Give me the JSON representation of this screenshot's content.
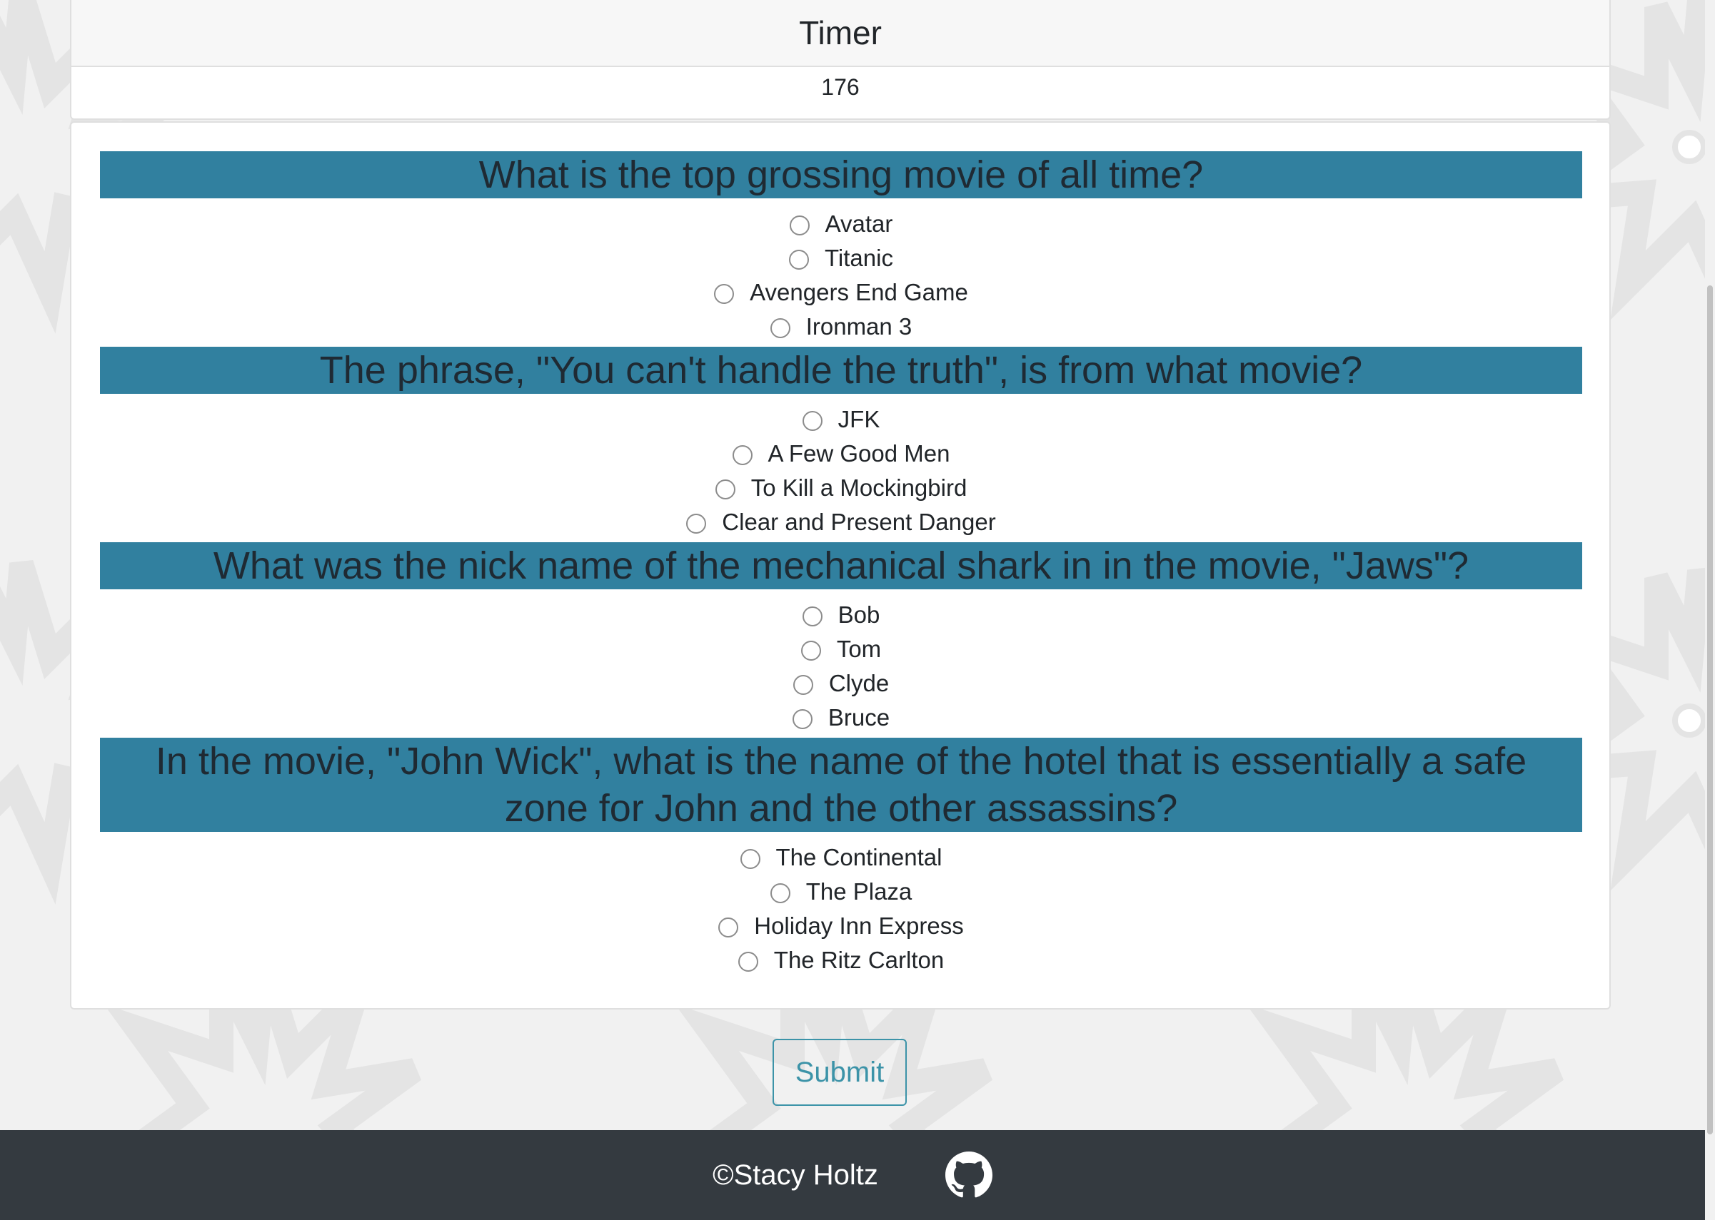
{
  "timer": {
    "title": "Timer",
    "value": "176"
  },
  "questions": [
    {
      "text": "What is the top grossing movie of all time?",
      "answers": [
        "Avatar",
        "Titanic",
        "Avengers End Game",
        "Ironman 3"
      ]
    },
    {
      "text": "The phrase, \"You can't handle the truth\", is from what movie?",
      "answers": [
        "JFK",
        "A Few Good Men",
        "To Kill a Mockingbird",
        "Clear and Present Danger"
      ]
    },
    {
      "text": "What was the nick name of the mechanical shark in in the movie, \"Jaws\"?",
      "answers": [
        "Bob",
        "Tom",
        "Clyde",
        "Bruce"
      ]
    },
    {
      "text": "In the movie, \"John Wick\", what is the name of the hotel that is essentially a safe zone for John and the other assassins?",
      "answers": [
        "The Continental",
        "The Plaza",
        "Holiday Inn Express",
        "The Ritz Carlton"
      ]
    }
  ],
  "submit": {
    "label": "Submit"
  },
  "footer": {
    "copyright": "©Stacy Holtz",
    "icon": "github-icon"
  },
  "colors": {
    "question_bar": "#31809f",
    "submit_accent": "#3c93a8",
    "footer_bg": "#343a40",
    "page_bg": "#f1f1f1"
  }
}
